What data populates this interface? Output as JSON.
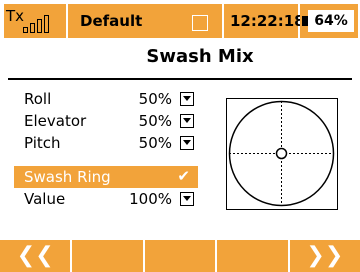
{
  "status": {
    "tx_label": "Tx",
    "signal_bars": 4,
    "model_name": "Default",
    "time": "12:22:18",
    "battery_text": "64%",
    "battery_level": 0.64
  },
  "page": {
    "title": "Swash Mix"
  },
  "rows": [
    {
      "label": "Roll",
      "value": "50%"
    },
    {
      "label": "Elevator",
      "value": "50%"
    },
    {
      "label": "Pitch",
      "value": "50%"
    }
  ],
  "swash_ring": {
    "label": "Swash Ring",
    "checked": true,
    "check_glyph": "✔"
  },
  "value_row": {
    "label": "Value",
    "value": "100%"
  },
  "nav": {
    "left": "❮❮",
    "right": "❯❯"
  },
  "colors": {
    "accent": "#f2a33a",
    "text": "#000000",
    "background": "#ffffff"
  }
}
